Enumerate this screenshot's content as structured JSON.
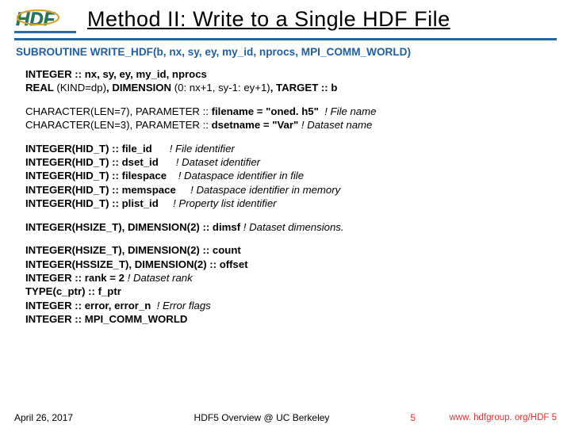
{
  "logo_text": "HDF",
  "title": "Method II: Write to a Single HDF File",
  "signature": "SUBROUTINE WRITE_HDF(b, nx, sy, ey, my_id, nprocs, MPI_COMM_WORLD)",
  "blocks": [
    [
      {
        "b": "INTEGER :: nx, sy, ey, my_id, nprocs"
      },
      {
        "b": "REAL ",
        "t": "(KIND=dp)",
        "b2": ", DIMENSION ",
        "t2": "(0: nx+1, sy-1: ey+1)",
        "b3": ", TARGET :: b"
      }
    ],
    [
      {
        "t": "CHARACTER(LEN=7), PARAMETER :: ",
        "b": "filename = \"oned. h5\"",
        "i": "  ! File name"
      },
      {
        "t": "CHARACTER(LEN=3), PARAMETER :: ",
        "b": "dsetname = \"Var\"",
        "i": " ! Dataset name"
      }
    ],
    [
      {
        "b": "INTEGER(HID_T) :: file_id",
        "i": "      ! File identifier"
      },
      {
        "b": "INTEGER(HID_T) :: dset_id",
        "i": "      ! Dataset identifier"
      },
      {
        "b": "INTEGER(HID_T) :: filespace",
        "i": "    ! Dataspace identifier in file"
      },
      {
        "b": "INTEGER(HID_T) :: memspace",
        "i": "     ! Dataspace identifier in memory"
      },
      {
        "b": "INTEGER(HID_T) :: plist_id",
        "i": "     ! Property list identifier"
      }
    ],
    [
      {
        "b": "INTEGER(HSIZE_T), DIMENSION(2) :: dimsf",
        "i": " ! Dataset dimensions."
      }
    ],
    [
      {
        "b": "INTEGER(HSIZE_T), DIMENSION(2) :: count"
      },
      {
        "b": "INTEGER(HSSIZE_T), DIMENSION(2) :: offset"
      },
      {
        "b": "INTEGER :: rank = 2",
        "i": " ! Dataset rank"
      },
      {
        "b": "TYPE(c_ptr) :: f_ptr"
      },
      {
        "b": "INTEGER :: error, error_n ",
        "i": " ! Error flags"
      },
      {
        "b": "INTEGER :: MPI_COMM_WORLD"
      }
    ]
  ],
  "footer": {
    "date": "April 26, 2017",
    "mid": "HDF5 Overview @ UC Berkeley",
    "page": "5",
    "url": "www. hdfgroup. org/HDF 5"
  }
}
